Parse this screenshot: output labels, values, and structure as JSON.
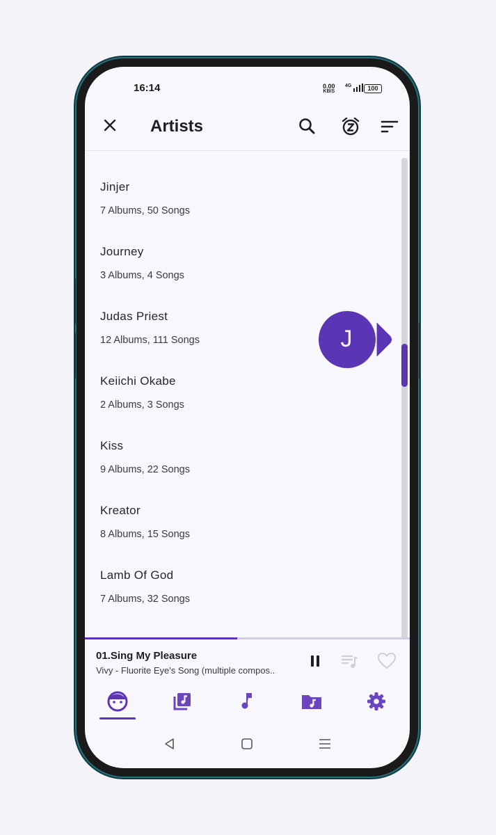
{
  "status_bar": {
    "time": "16:14",
    "net_speed": "0.00",
    "net_unit": "KB/S",
    "signal": "4G",
    "battery": "100"
  },
  "app_bar": {
    "title": "Artists",
    "close_icon": "close-icon",
    "search_icon": "search-icon",
    "sleep_timer_icon": "alarm-z-icon",
    "sort_icon": "sort-icon"
  },
  "artists": [
    {
      "name": "Jinjer",
      "info": "7 Albums, 50 Songs"
    },
    {
      "name": "Journey",
      "info": "3 Albums,  4 Songs"
    },
    {
      "name": "Judas Priest",
      "info": "12 Albums, 111 Songs"
    },
    {
      "name": "Keiichi Okabe",
      "info": "2 Albums,  3 Songs"
    },
    {
      "name": "Kiss",
      "info": "9 Albums, 22 Songs"
    },
    {
      "name": "Kreator",
      "info": "8 Albums, 15 Songs"
    },
    {
      "name": "Lamb Of God",
      "info": "7 Albums, 32 Songs"
    }
  ],
  "scroll_bubble": {
    "letter": "J"
  },
  "now_playing": {
    "song": "01.Sing My Pleasure",
    "artist": "Vivy - Fluorite Eye's Song (multiple compos..",
    "progress": 0.47
  },
  "bottom_nav": {
    "tabs": [
      {
        "name": "artists",
        "icon": "face-icon",
        "selected": true
      },
      {
        "name": "albums",
        "icon": "album-library-icon",
        "selected": false
      },
      {
        "name": "songs",
        "icon": "music-note-icon",
        "selected": false
      },
      {
        "name": "folders",
        "icon": "folder-music-icon",
        "selected": false
      },
      {
        "name": "settings",
        "icon": "gear-icon",
        "selected": false
      }
    ]
  },
  "colors": {
    "accent": "#5b35b3",
    "background": "#f8f7fc",
    "text": "#1e1e22"
  }
}
